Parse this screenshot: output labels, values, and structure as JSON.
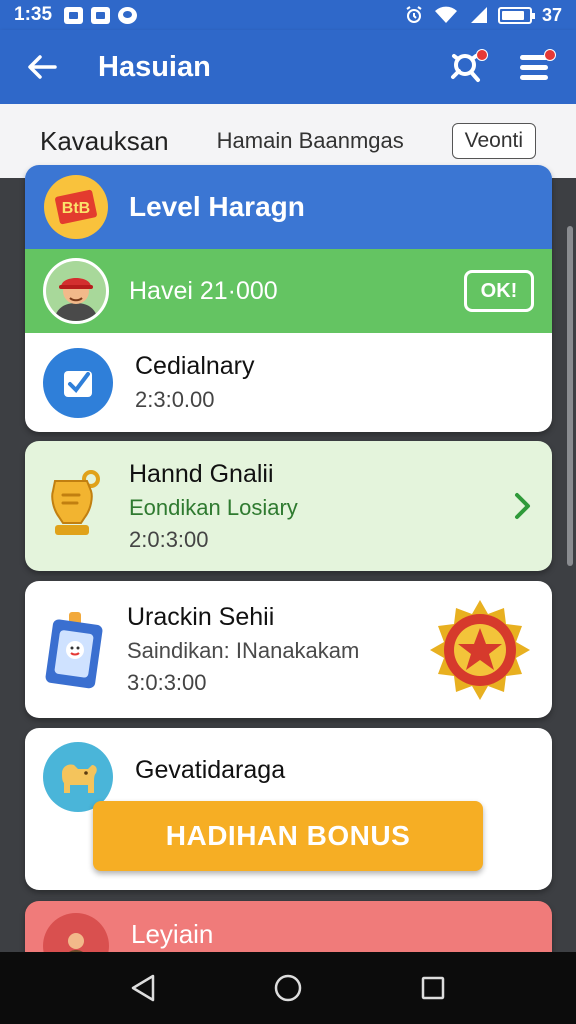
{
  "status_bar": {
    "time": "1:35",
    "battery": "37"
  },
  "app_bar": {
    "title": "Hasuian"
  },
  "filter_bar": {
    "primary": "Kavauksan",
    "secondary": "Hamain Baanmgas",
    "button": "Veonti"
  },
  "level_card": {
    "title": "Level Haragn",
    "badge_text": "BtB",
    "user_score": "Havei 21·000",
    "ok_label": "OK!",
    "item_title": "Cedialnary",
    "item_time": "2:3:0.00"
  },
  "hand_card": {
    "title": "Hannd Gnalii",
    "subtitle": "Eondikan Losiary",
    "time": "2:0:3:00"
  },
  "ur_card": {
    "title": "Urackin Sehii",
    "subtitle": "Saindikan: INanakakam",
    "time": "3:0:3:00"
  },
  "gev_card": {
    "title": "Gevatidaraga",
    "bonus_label": "HADIHAN BONUS"
  },
  "ley_card": {
    "title": "Leyiain"
  },
  "colors": {
    "primary": "#2f68c9",
    "green": "#64c462",
    "light_green": "#e4f4dc",
    "orange": "#f6ae24",
    "red": "#f07b7a"
  }
}
